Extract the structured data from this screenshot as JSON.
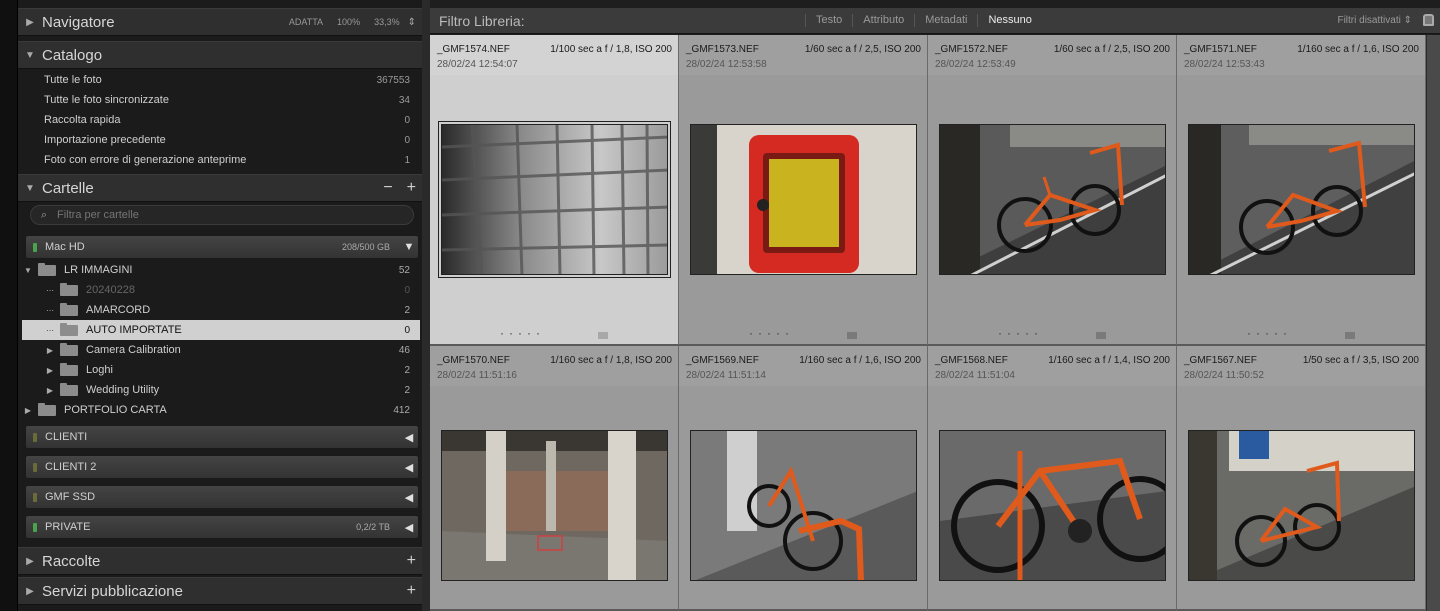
{
  "navigator": {
    "title": "Navigatore",
    "zoom_fit": "ADATTA",
    "zoom_100": "100%",
    "zoom_pct": "33,3%"
  },
  "catalog": {
    "title": "Catalogo",
    "items": [
      {
        "label": "Tutte le foto",
        "count": "367553"
      },
      {
        "label": "Tutte le foto sincronizzate",
        "count": "34"
      },
      {
        "label": "Raccolta rapida",
        "count": "0"
      },
      {
        "label": "Importazione precedente",
        "count": "0"
      },
      {
        "label": "Foto con errore di generazione anteprime",
        "count": "1"
      }
    ]
  },
  "folders": {
    "title": "Cartelle",
    "filter_placeholder": "Filtra per cartelle",
    "volume": {
      "name": "Mac HD",
      "size": "208/500 GB"
    },
    "tree": [
      {
        "name": "LR IMMAGINI",
        "count": "52"
      },
      {
        "name": "20240228",
        "count": "0"
      },
      {
        "name": "AMARCORD",
        "count": "2"
      },
      {
        "name": "AUTO IMPORTATE",
        "count": "0"
      },
      {
        "name": "Camera Calibration",
        "count": "46"
      },
      {
        "name": "Loghi",
        "count": "2"
      },
      {
        "name": "Wedding Utility",
        "count": "2"
      },
      {
        "name": "PORTFOLIO CARTA",
        "count": "412"
      }
    ],
    "other_volumes": [
      {
        "name": "CLIENTI",
        "size": ""
      },
      {
        "name": "CLIENTI 2",
        "size": ""
      },
      {
        "name": "GMF SSD",
        "size": ""
      },
      {
        "name": "PRIVATE",
        "size": "0,2/2 TB"
      }
    ]
  },
  "collections": {
    "title": "Raccolte"
  },
  "publish": {
    "title": "Servizi pubblicazione"
  },
  "library_filter": {
    "title": "Filtro Libreria:",
    "tabs": [
      "Testo",
      "Attributo",
      "Metadati",
      "Nessuno"
    ],
    "active_tab": "Nessuno",
    "status": "Filtri disattivati"
  },
  "photos": [
    {
      "file": "_GMF1574.NEF",
      "exif": "1/100 sec a f / 1,8, ISO 200",
      "date": "28/02/24 12:54:07",
      "subject": "glass-block-wall",
      "selected": true
    },
    {
      "file": "_GMF1573.NEF",
      "exif": "1/60 sec a f / 2,5, ISO 200",
      "date": "28/02/24 12:53:58",
      "subject": "fire-alarm-box"
    },
    {
      "file": "_GMF1572.NEF",
      "exif": "1/60 sec a f / 2,5, ISO 200",
      "date": "28/02/24 12:53:49",
      "subject": "orange-bicycle"
    },
    {
      "file": "_GMF1571.NEF",
      "exif": "1/160 sec a f / 1,6, ISO 200",
      "date": "28/02/24 12:53:43",
      "subject": "orange-bicycle"
    },
    {
      "file": "_GMF1570.NEF",
      "exif": "1/160 sec a f / 1,8, ISO 200",
      "date": "28/02/24 11:51:16",
      "subject": "concrete-pillars"
    },
    {
      "file": "_GMF1569.NEF",
      "exif": "1/160 sec a f / 1,6, ISO 200",
      "date": "28/02/24 11:51:14",
      "subject": "bicycle-on-rack"
    },
    {
      "file": "_GMF1568.NEF",
      "exif": "1/160 sec a f / 1,4, ISO 200",
      "date": "28/02/24 11:51:04",
      "subject": "bicycle-closeup"
    },
    {
      "file": "_GMF1567.NEF",
      "exif": "1/50 sec a f / 3,5, ISO 200",
      "date": "28/02/24 11:50:52",
      "subject": "orange-bicycle"
    }
  ],
  "colors": {
    "accent": "#d0d0d0",
    "grid_bg": "#9a9a9a",
    "bike_orange": "#e05a1c"
  }
}
